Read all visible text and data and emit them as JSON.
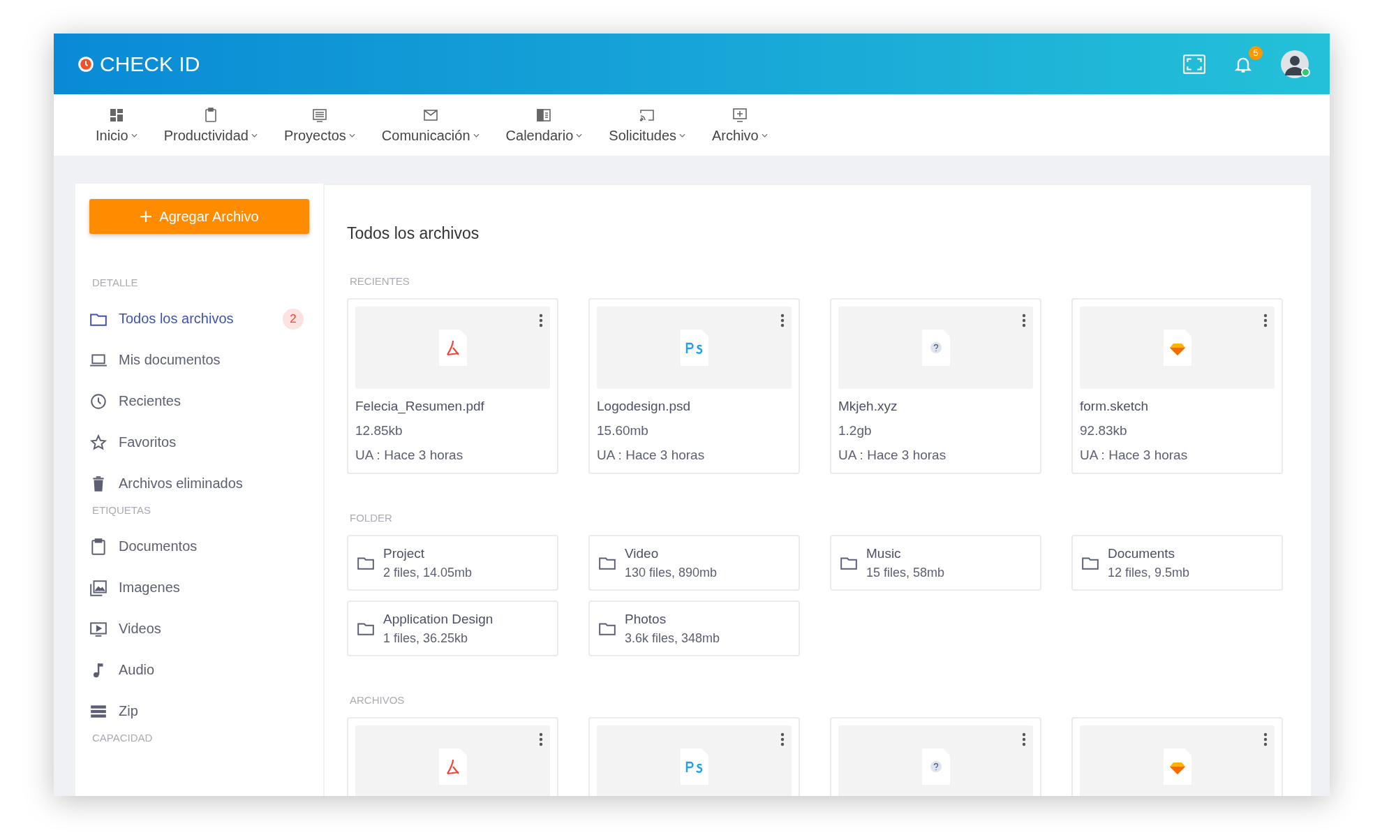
{
  "header": {
    "logo": "CHECK ID",
    "notifications": "5",
    "avatar": {
      "online": true
    }
  },
  "nav": [
    {
      "label": "Inicio"
    },
    {
      "label": "Productividad"
    },
    {
      "label": "Proyectos"
    },
    {
      "label": "Comunicación"
    },
    {
      "label": "Calendario"
    },
    {
      "label": "Solicitudes"
    },
    {
      "label": "Archivo"
    }
  ],
  "sidebar": {
    "add_button": "Agregar Archivo",
    "sections": [
      {
        "title": "DETALLE",
        "items": [
          {
            "label": "Todos los archivos",
            "selected": true,
            "badge": "2"
          },
          {
            "label": "Mis documentos",
            "selected": false
          },
          {
            "label": "Recientes",
            "selected": false
          },
          {
            "label": "Favoritos",
            "selected": false
          },
          {
            "label": "Archivos eliminados",
            "selected": false
          }
        ]
      },
      {
        "title": "ETIQUETAS",
        "items": [
          {
            "label": "Documentos",
            "selected": false
          },
          {
            "label": "Imagenes",
            "selected": false
          },
          {
            "label": "Videos",
            "selected": false
          },
          {
            "label": "Audio",
            "selected": false
          },
          {
            "label": "Zip",
            "selected": false
          }
        ]
      },
      {
        "title": "CAPACIDAD"
      }
    ]
  },
  "main": {
    "title": "Todos los archivos",
    "recent": {
      "title": "RECIENTES",
      "files": [
        {
          "kind": "pdf",
          "name": "Felecia_Resumen.pdf",
          "size": "12.85kb",
          "updated": "UA : Hace 3 horas"
        },
        {
          "kind": "psd",
          "name": "Logodesign.psd",
          "size": "15.60mb",
          "updated": "UA : Hace 3 horas"
        },
        {
          "kind": "unknown",
          "name": "Mkjeh.xyz",
          "size": "1.2gb",
          "updated": "UA : Hace 3 horas"
        },
        {
          "kind": "sketch",
          "name": "form.sketch",
          "size": "92.83kb",
          "updated": "UA : Hace 3 horas"
        }
      ]
    },
    "folders": {
      "title": "FOLDER",
      "items": [
        {
          "name": "Project",
          "info": "2 files, 14.05mb"
        },
        {
          "name": "Video",
          "info": "130 files, 890mb"
        },
        {
          "name": "Music",
          "info": "15 files, 58mb"
        },
        {
          "name": "Documents",
          "info": "12 files, 9.5mb"
        },
        {
          "name": "Application Design",
          "info": "1 files, 36.25kb"
        },
        {
          "name": "Photos",
          "info": "3.6k files, 348mb"
        }
      ]
    },
    "files": {
      "title": "ARCHIVOS",
      "files": [
        {
          "kind": "pdf"
        },
        {
          "kind": "psd"
        },
        {
          "kind": "unknown"
        },
        {
          "kind": "sketch"
        }
      ]
    }
  }
}
